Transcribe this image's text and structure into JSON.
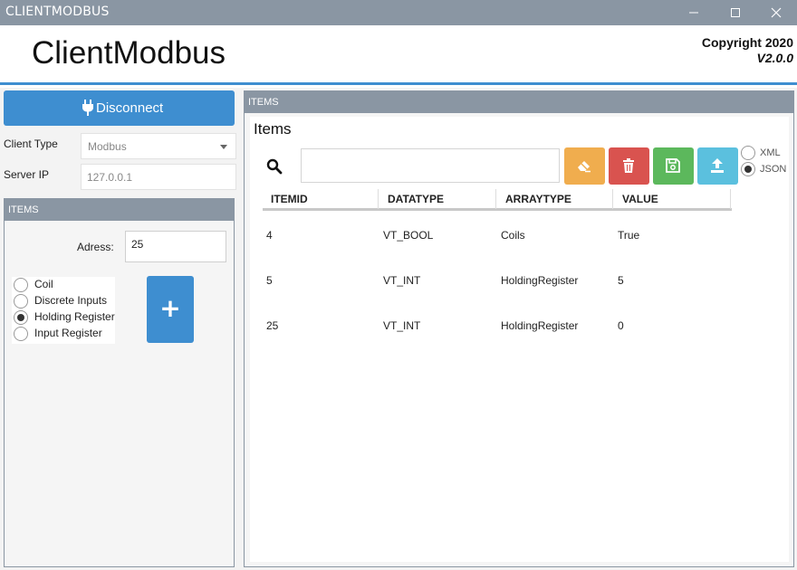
{
  "window": {
    "title": "CLIENTMODBUS",
    "controls": [
      "minimize",
      "maximize",
      "close"
    ]
  },
  "header": {
    "app_name": "ClientModbus",
    "copyright": "Copyright 2020",
    "version": "V2.0.0"
  },
  "connection": {
    "disconnect_label": "Disconnect",
    "client_type_label": "Client Type",
    "client_type_value": "Modbus",
    "server_ip_label": "Server IP",
    "server_ip_value": "127.0.0.1"
  },
  "items_panel": {
    "header": "ITEMS",
    "address_label": "Adress:",
    "address_value": "25",
    "register_types": [
      {
        "label": "Coil",
        "checked": false
      },
      {
        "label": "Discrete Inputs",
        "checked": false
      },
      {
        "label": "Holding Register",
        "checked": true
      },
      {
        "label": "Input Register",
        "checked": false
      }
    ],
    "add_label": "+"
  },
  "items_view": {
    "header": "ITEMS",
    "title": "Items",
    "search_value": "",
    "buttons": [
      {
        "name": "clear",
        "color": "#f0ad4e",
        "icon": "eraser-icon"
      },
      {
        "name": "delete",
        "color": "#d9534f",
        "icon": "trash-icon"
      },
      {
        "name": "save",
        "color": "#5cb85c",
        "icon": "save-icon"
      },
      {
        "name": "upload",
        "color": "#5bc0de",
        "icon": "upload-icon"
      }
    ],
    "formats": [
      {
        "label": "XML",
        "checked": false
      },
      {
        "label": "JSON",
        "checked": true
      }
    ],
    "columns": [
      "ITEMID",
      "DATATYPE",
      "ARRAYTYPE",
      "VALUE"
    ],
    "rows": [
      [
        "4",
        "VT_BOOL",
        "Coils",
        "True"
      ],
      [
        "5",
        "VT_INT",
        "HoldingRegister",
        "5"
      ],
      [
        "25",
        "VT_INT",
        "HoldingRegister",
        "0"
      ]
    ]
  },
  "colors": {
    "accent": "#3e8ed0",
    "titlebar": "#8a96a3"
  }
}
